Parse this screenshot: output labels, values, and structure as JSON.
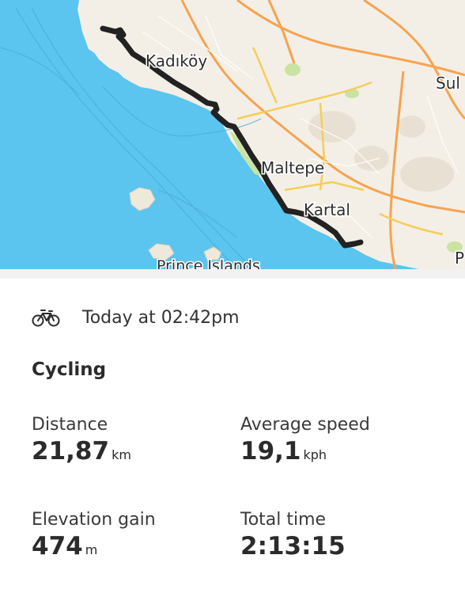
{
  "map": {
    "labels": {
      "kadikoy": "Kadıköy",
      "maltepe": "Maltepe",
      "kartal": "Kartal",
      "sul": "Sul",
      "prince_islands": "Prince Islands",
      "p_edge": "P"
    },
    "colors": {
      "water": "#5bc4ef",
      "land": "#f3efe6",
      "route": "#222222",
      "road_major": "#f6a350",
      "road_minor": "#f5cd58",
      "park": "#c9e3a3"
    }
  },
  "activity": {
    "icon": "bicycle-icon",
    "time": "Today at 02:42pm",
    "type": "Cycling"
  },
  "stats": {
    "distance": {
      "label": "Distance",
      "value": "21,87",
      "unit": "km"
    },
    "average_speed": {
      "label": "Average speed",
      "value": "19,1",
      "unit": "kph"
    },
    "elevation_gain": {
      "label": "Elevation gain",
      "value": "474",
      "unit": "m"
    },
    "total_time": {
      "label": "Total time",
      "value": "2:13:15",
      "unit": ""
    }
  }
}
